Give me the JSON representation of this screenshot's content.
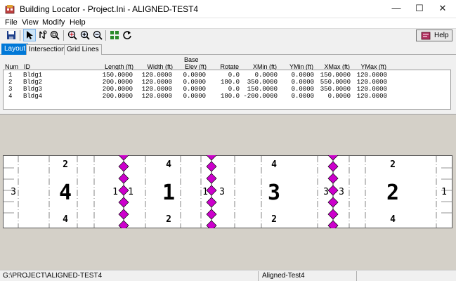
{
  "window": {
    "title": "Building Locator - Project.Ini - ALIGNED-TEST4",
    "minimize": "—",
    "maximize": "☐",
    "close": "✕"
  },
  "menu": [
    "File",
    "View",
    "Modify",
    "Help"
  ],
  "toolbar": {
    "icons": [
      "save-icon",
      "pointer-icon",
      "pan-icon",
      "zoom-window-icon",
      "zoom-extents-icon",
      "zoom-in-icon",
      "zoom-out-icon",
      "grid-icon",
      "refresh-icon"
    ],
    "help_label": "Help"
  },
  "tabs": [
    "Layout",
    "Intersections",
    "Grid Lines"
  ],
  "table": {
    "headers": {
      "num": "Num",
      "id": "ID",
      "length": "Length  (ft)",
      "width": "Width  (ft)",
      "base_top": "Base",
      "base_bottom": "Elev  (ft)",
      "rotate": "Rotate",
      "xmin": "XMin  (ft)",
      "ymin": "YMin  (ft)",
      "xmax": "XMax  (ft)",
      "ymax": "YMax  (ft)"
    },
    "rows": [
      [
        "1",
        "Bldg1",
        "150.0000",
        "120.0000",
        "0.0000",
        "0.0",
        "0.0000",
        "0.0000",
        "150.0000",
        "120.0000"
      ],
      [
        "2",
        "Bldg2",
        "200.0000",
        "120.0000",
        "0.0000",
        "180.0",
        "350.0000",
        "0.0000",
        "550.0000",
        "120.0000"
      ],
      [
        "3",
        "Bldg3",
        "200.0000",
        "120.0000",
        "0.0000",
        "0.0",
        "150.0000",
        "0.0000",
        "350.0000",
        "120.0000"
      ],
      [
        "4",
        "Bldg4",
        "200.0000",
        "120.0000",
        "0.0000",
        "180.0",
        "-200.0000",
        "0.0000",
        "0.0000",
        "120.0000"
      ]
    ]
  },
  "plot": {
    "buildings": [
      {
        "label": "4",
        "top": "2",
        "bottom": "4",
        "left": "3",
        "right": "1"
      },
      {
        "label": "1",
        "top": "4",
        "bottom": "2",
        "left": "1",
        "right": "3"
      },
      {
        "label": "3",
        "top": "4",
        "bottom": "2",
        "left": "1",
        "right": "3"
      },
      {
        "label": "2",
        "top": "2",
        "bottom": "4",
        "left": "3",
        "right": "1"
      }
    ],
    "diamond_color": "#cc00cc",
    "background_color": "#d4d0c8"
  },
  "status": {
    "path": "G:\\PROJECT\\ALIGNED-TEST4",
    "name": "Aligned-Test4"
  }
}
